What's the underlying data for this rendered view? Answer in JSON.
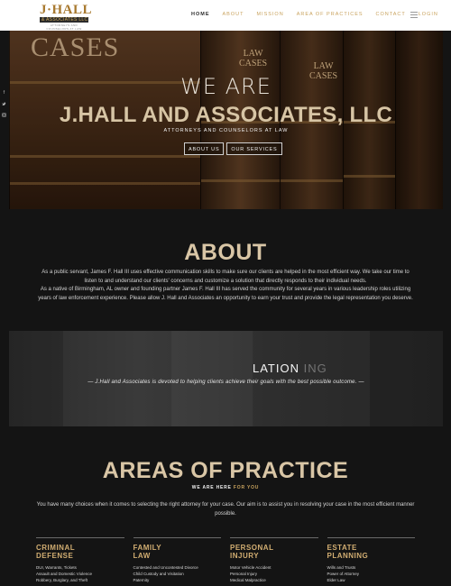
{
  "header": {
    "logo_main": "J·HALL",
    "logo_sub": "& ASSOCIATES LLC",
    "logo_tag": "ATTORNEYS AND COUNSELORS AT LAW",
    "nav": [
      "HOME",
      "ABOUT",
      "MISSION",
      "AREA OF PRACTICES",
      "CONTACT",
      "LOGIN"
    ],
    "menu_icon": "hamburger-icon"
  },
  "social": [
    "facebook-icon",
    "twitter-icon",
    "instagram-icon"
  ],
  "hero": {
    "spine_cases": "CASES",
    "spine_law_cases_1": "LAW\nCASES",
    "spine_law_cases_2": "LAW\nCASES",
    "we_are": "WE ARE",
    "title": "J.HALL AND ASSOCIATES, LLC",
    "subtitle": "ATTORNEYS AND COUNSELORS AT LAW",
    "buttons": [
      "ABOUT US",
      "OUR SERVICES"
    ]
  },
  "about": {
    "heading": "ABOUT",
    "paragraphs": [
      "As a public servant, James F. Hall III uses effective communication skills to make sure our clients are helped in the most efficient way. We take our time to listen to and understand our clients' concerns and customize a solution that directly responds to their individual needs.",
      "As a native of Birmingham, AL owner and founding partner James F. Hall III has served the community for several years in various leadership roles utilizing years of law enforcement experience. Please allow J. Hall and Associates an opportunity to earn your trust and provide the legal representation you deserve."
    ]
  },
  "banner": {
    "faded_text": "LATION",
    "faded_ghost": "ING",
    "quote": "— J.Hall and Associates is devoted to helping clients achieve their goals with the best possible outcome. —"
  },
  "areas": {
    "heading": "AREAS OF PRACTICE",
    "sub_white": "WE ARE HERE",
    "sub_accent": "FOR YOU",
    "text": "You have many choices when it comes to selecting the right attorney for your case. Our aim is to assist you in resolving your case in the most efficient manner possible.",
    "columns": [
      {
        "title": "CRIMINAL\nDEFENSE",
        "items": [
          "DUI, Warrants, Tickets",
          "Assault and Domestic Violence",
          "Robbery, Burglary, and Theft"
        ]
      },
      {
        "title": "FAMILY\nLAW",
        "items": [
          "Contested and Uncontested Divorce",
          "Child Custody and Visitation",
          "Paternity"
        ]
      },
      {
        "title": "PERSONAL\nINJURY",
        "items": [
          "Motor Vehicle Accident",
          "Personal Injury",
          "Medical Malpractice"
        ]
      },
      {
        "title": "ESTATE\nPLANNING",
        "items": [
          "Wills and Trusts",
          "Power of Attorney",
          "Elder Law"
        ]
      }
    ]
  }
}
